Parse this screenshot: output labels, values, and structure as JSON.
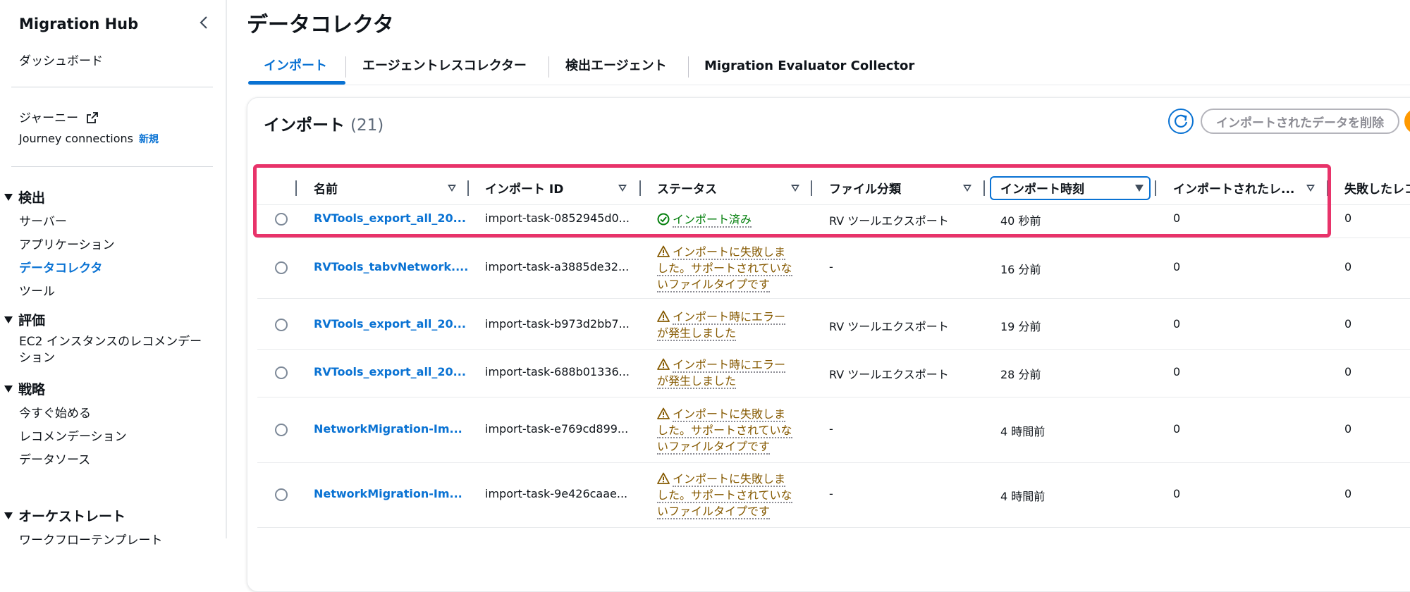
{
  "sidebar": {
    "title": "Migration Hub",
    "dashboard": "ダッシュボード",
    "journey": "ジャーニー",
    "journey_connections": "Journey connections",
    "new_badge": "新規",
    "sections": [
      {
        "label": "検出",
        "items": [
          "サーバー",
          "アプリケーション",
          "データコレクタ",
          "ツール"
        ]
      },
      {
        "label": "評価",
        "items": [
          "EC2 インスタンスのレコメンデーション"
        ]
      },
      {
        "label": "戦略",
        "items": [
          "今すぐ始める",
          "レコメンデーション",
          "データソース"
        ]
      },
      {
        "label": "オーケストレート",
        "items": [
          "ワークフローテンプレート"
        ]
      }
    ],
    "active_item": "データコレクタ"
  },
  "page": {
    "title": "データコレクタ",
    "tabs": [
      "インポート",
      "エージェントレスコレクター",
      "検出エージェント",
      "Migration Evaluator Collector"
    ],
    "active_tab": "インポート"
  },
  "imports": {
    "title": "インポート",
    "count": "(21)",
    "delete_button": "インポートされたデータを削除",
    "columns": [
      "名前",
      "インポート ID",
      "ステータス",
      "ファイル分類",
      "インポート時刻",
      "インポートされたレ...",
      "失敗したレコ"
    ],
    "sorted_column": "インポート時刻",
    "rows": [
      {
        "name": "RVTools_export_all_20...",
        "id": "import-task-0852945d0...",
        "status": "インポート済み",
        "status_type": "ok",
        "status_lines": [
          "インポート済み"
        ],
        "file_type": "RV ツールエクスポート",
        "time": "40 秒前",
        "imported": "0",
        "failed": "0"
      },
      {
        "name": "RVTools_tabvNetwork....",
        "id": "import-task-a3885de32...",
        "status": "インポートに失敗しました。サポートされていないファイルタイプです",
        "status_type": "warn",
        "status_lines": [
          "インポートに失敗しま",
          "した。サポートされていな",
          "いファイルタイプです"
        ],
        "file_type": "-",
        "time": "16 分前",
        "imported": "0",
        "failed": "0"
      },
      {
        "name": "RVTools_export_all_20...",
        "id": "import-task-b973d2bb7...",
        "status": "インポート時にエラーが発生しました",
        "status_type": "warn",
        "status_lines": [
          "インポート時にエラー",
          "が発生しました"
        ],
        "file_type": "RV ツールエクスポート",
        "time": "19 分前",
        "imported": "0",
        "failed": "0"
      },
      {
        "name": "RVTools_export_all_20...",
        "id": "import-task-688b01336...",
        "status": "インポート時にエラーが発生しました",
        "status_type": "warn",
        "status_lines": [
          "インポート時にエラー",
          "が発生しました"
        ],
        "file_type": "RV ツールエクスポート",
        "time": "28 分前",
        "imported": "0",
        "failed": "0"
      },
      {
        "name": "NetworkMigration-Im...",
        "id": "import-task-e769cd899...",
        "status": "インポートに失敗しました。サポートされていないファイルタイプです",
        "status_type": "warn",
        "status_lines": [
          "インポートに失敗しま",
          "した。サポートされていな",
          "いファイルタイプです"
        ],
        "file_type": "-",
        "time": "4 時間前",
        "imported": "0",
        "failed": "0"
      },
      {
        "name": "NetworkMigration-Im...",
        "id": "import-task-9e426caae...",
        "status": "インポートに失敗しました。サポートされていないファイルタイプです",
        "status_type": "warn",
        "status_lines": [
          "インポートに失敗しま",
          "した。サポートされていな",
          "いファイルタイプです"
        ],
        "file_type": "-",
        "time": "4 時間前",
        "imported": "0",
        "failed": "0"
      }
    ]
  },
  "colors": {
    "link": "#0972d3",
    "success": "#037f0c",
    "warning": "#855900",
    "highlight": "#e8336a",
    "accent": "#ff9900"
  }
}
